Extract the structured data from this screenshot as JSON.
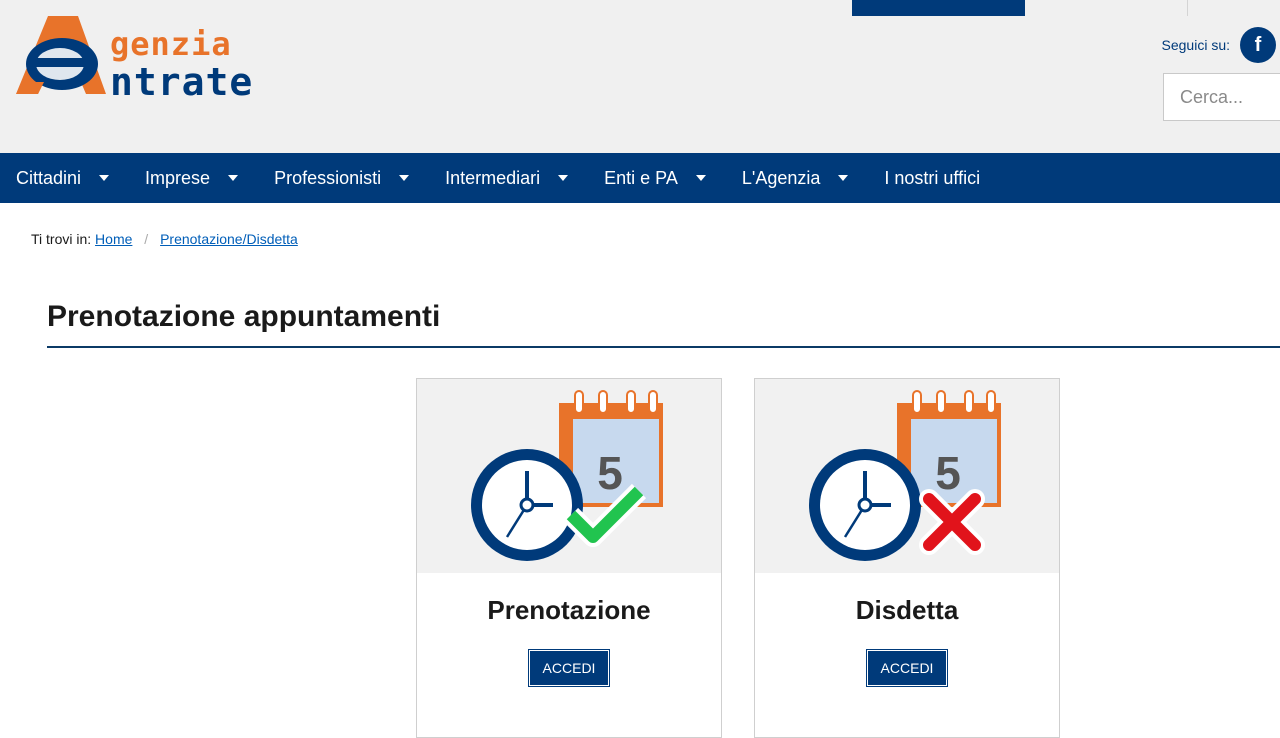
{
  "header": {
    "logo": {
      "line1": "genzia",
      "line2": "ntrate",
      "monogram": "A"
    },
    "social_label": "Seguici su:",
    "social_icon": "facebook-icon",
    "search_placeholder": "Cerca..."
  },
  "nav": {
    "items": [
      {
        "label": "Cittadini",
        "dropdown": true
      },
      {
        "label": "Imprese",
        "dropdown": true
      },
      {
        "label": "Professionisti",
        "dropdown": true
      },
      {
        "label": "Intermediari",
        "dropdown": true
      },
      {
        "label": "Enti e PA",
        "dropdown": true
      },
      {
        "label": "L'Agenzia",
        "dropdown": true
      },
      {
        "label": "I nostri uffici",
        "dropdown": false
      }
    ]
  },
  "breadcrumb": {
    "prefix": "Ti trovi in:",
    "items": [
      "Home",
      "Prenotazione/Disdetta"
    ]
  },
  "page": {
    "title": "Prenotazione appuntamenti"
  },
  "cards": [
    {
      "title": "Prenotazione",
      "button": "ACCEDI",
      "calendar_day": "5",
      "status_icon": "checkmark-icon"
    },
    {
      "title": "Disdetta",
      "button": "ACCEDI",
      "calendar_day": "5",
      "status_icon": "cross-icon"
    }
  ],
  "colors": {
    "brand_blue": "#003a7a",
    "brand_orange": "#e8732a",
    "check_green": "#21c44f",
    "cross_red": "#e1131b",
    "link_blue": "#005eb8"
  }
}
